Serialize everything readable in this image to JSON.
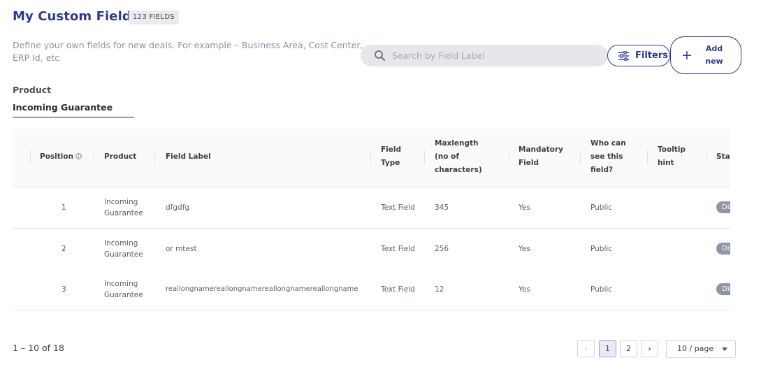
{
  "header": {
    "title": "My Custom Fields",
    "count_badge": "123 FIELDS",
    "description": "Define your own fields for new deals. For example – Business Area, Cost Center, ERP Id, etc"
  },
  "search": {
    "placeholder": "Search by Field Label",
    "value": ""
  },
  "toolbar": {
    "filters_label": "Filters",
    "add_label": "Add new"
  },
  "product_filter": {
    "label": "Product",
    "value": "Incoming Guarantee"
  },
  "table": {
    "columns": {
      "position": "Position",
      "product": "Product",
      "field_label": "Field Label",
      "field_type": "Field Type",
      "maxlength": "Maxlength (no of characters)",
      "mandatory": "Mandatory Field",
      "visibility": "Who can see this field?",
      "tooltip": "Tooltip hint",
      "status": "Status"
    },
    "rows": [
      {
        "position": "1",
        "product": "Incoming Guarantee",
        "field_label": "dfgdfg",
        "field_type": "Text Field",
        "maxlength": "345",
        "mandatory": "Yes",
        "visibility": "Public",
        "tooltip": "",
        "status": "Disabled"
      },
      {
        "position": "2",
        "product": "Incoming Guarantee",
        "field_label": "or mtest",
        "field_type": "Text Field",
        "maxlength": "256",
        "mandatory": "Yes",
        "visibility": "Public",
        "tooltip": "",
        "status": "Disabled"
      },
      {
        "position": "3",
        "product": "Incoming Guarantee",
        "field_label": "reallongnamereallongnamereallongnamereallongname",
        "field_type": "Text Field",
        "maxlength": "12",
        "mandatory": "Yes",
        "visibility": "Public",
        "tooltip": "",
        "status": "Disabled"
      }
    ]
  },
  "pagination": {
    "summary": "1 – 10 of 18",
    "pages": [
      "1",
      "2"
    ],
    "current_page": "1",
    "page_size": "10 / page"
  },
  "colors": {
    "accent": "#2f3a8f",
    "status_badge": "#8e96a4"
  }
}
